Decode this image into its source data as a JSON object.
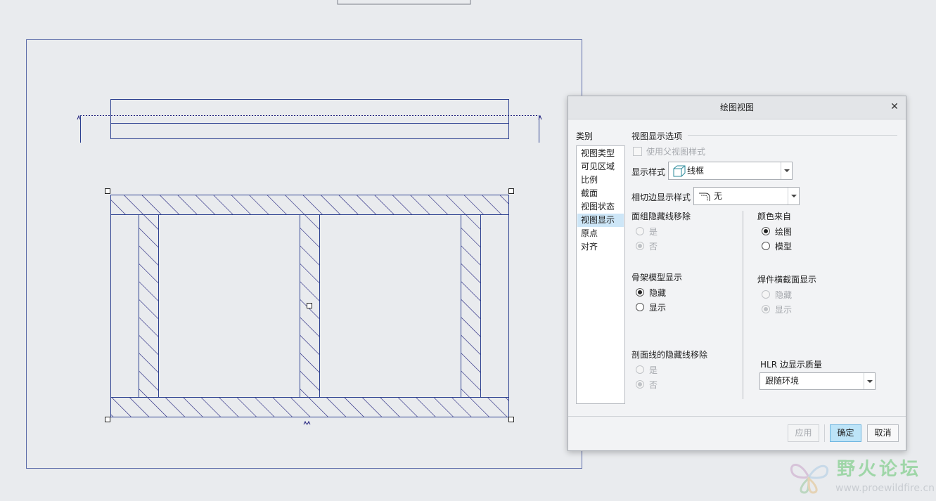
{
  "dialog": {
    "title": "绘图视图",
    "category_label": "类别",
    "categories": [
      {
        "label": "视图类型",
        "selected": false
      },
      {
        "label": "可见区域",
        "selected": false
      },
      {
        "label": "比例",
        "selected": false
      },
      {
        "label": "截面",
        "selected": false
      },
      {
        "label": "视图状态",
        "selected": false
      },
      {
        "label": "视图显示",
        "selected": true
      },
      {
        "label": "原点",
        "selected": false
      },
      {
        "label": "对齐",
        "selected": false
      }
    ],
    "section_title": "视图显示选项",
    "use_parent_style": {
      "label": "使用父视图样式",
      "checked": false,
      "enabled": false
    },
    "display_style": {
      "label": "显示样式",
      "value": "线框",
      "icon": "wireframe-cube-icon"
    },
    "tangent_style": {
      "label": "相切边显示样式",
      "value": "无",
      "icon": "tangent-edge-icon"
    },
    "quilt_hidden": {
      "label": "面组隐藏线移除",
      "options": [
        "是",
        "否"
      ],
      "selected": 1,
      "enabled": false
    },
    "color_from": {
      "label": "颜色来自",
      "options": [
        "绘图",
        "模型"
      ],
      "selected": 0,
      "enabled": true
    },
    "skeleton": {
      "label": "骨架模型显示",
      "options": [
        "隐藏",
        "显示"
      ],
      "selected": 0,
      "enabled": true
    },
    "weld_xsec": {
      "label": "焊件横截面显示",
      "options": [
        "隐藏",
        "显示"
      ],
      "selected": 1,
      "enabled": false
    },
    "xhatch_hidden": {
      "label": "剖面线的隐藏线移除",
      "options": [
        "是",
        "否"
      ],
      "selected": 1,
      "enabled": false
    },
    "hlr_quality": {
      "label": "HLR 边显示质量",
      "value": "跟随环境"
    },
    "buttons": {
      "apply": "应用",
      "ok": "确定",
      "cancel": "取消"
    }
  },
  "watermark": {
    "main": "野火论坛",
    "url": "www.proewildfire.cn"
  },
  "colors": {
    "background": "#e9ebee",
    "drawing_line": "#2b3f8f",
    "hatch": "#1a1a7a",
    "selected_item": "#cde6f7",
    "primary_button": "#bde4f8"
  }
}
